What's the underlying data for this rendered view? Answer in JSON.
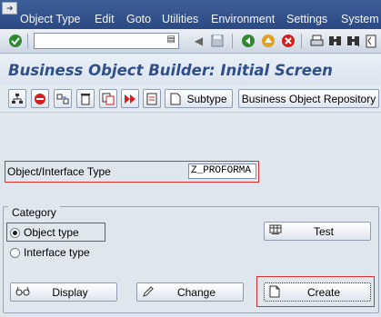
{
  "menu": [
    "Object Type",
    "Edit",
    "Goto",
    "Utilities",
    "Environment",
    "Settings",
    "System"
  ],
  "command_field": {
    "value": ""
  },
  "title": "Business Object Builder: Initial Screen",
  "app_toolbar": {
    "subtype_label": "Subtype",
    "repository_label": "Business Object Repository"
  },
  "object_field": {
    "label": "Object/Interface Type",
    "value": "Z_PROFORMA"
  },
  "category": {
    "title": "Category",
    "options": [
      "Object type",
      "Interface type"
    ],
    "selected": "Object type"
  },
  "buttons": {
    "test": "Test",
    "display": "Display",
    "change": "Change",
    "create": "Create"
  },
  "colors": {
    "menu_bg": "#26457f",
    "title_text": "#2f4f8a",
    "highlight": "#d9302e",
    "ok_check": "#2f8a2f",
    "cancel": "#d02020"
  },
  "icons": [
    "sap-menu-icon",
    "enter-check-icon",
    "command-pad-icon",
    "back-arrow-icon",
    "save-icon",
    "back-icon",
    "exit-icon",
    "cancel-icon",
    "print-icon",
    "find-icon",
    "find-next-icon",
    "first-page-icon"
  ]
}
